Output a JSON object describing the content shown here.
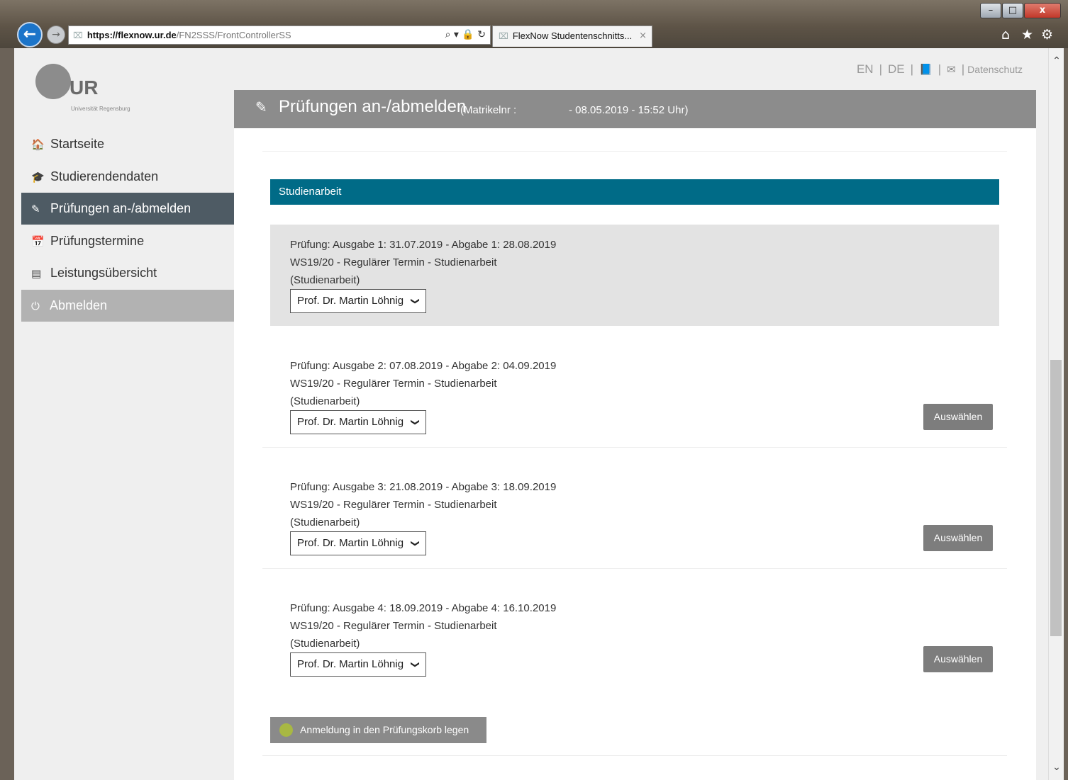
{
  "browser": {
    "url_host": "https://flexnow.ur.de",
    "url_path": "/FN2SSS/FrontControllerSS",
    "tab_title": "FlexNow Studentenschnitts...",
    "back_icon": "←",
    "forward_icon": "→",
    "minimize": "–",
    "maximize": "□",
    "close": "x",
    "tab_close": "×",
    "home_icon": "⌂",
    "favorites_icon": "★",
    "settings_icon": "⚙",
    "addr_tools": "⌕ ▾ 🔒 ↻"
  },
  "logo": {
    "letters": "UR",
    "subtitle": "Universität Regensburg"
  },
  "toplinks": {
    "en": "EN",
    "de": "DE",
    "sep": "|",
    "book_icon": "📘",
    "mail_icon": "✉",
    "privacy": "Datenschutz"
  },
  "sidebar": {
    "items": [
      {
        "icon": "🏠",
        "label": "Startseite"
      },
      {
        "icon": "🎓",
        "label": "Studierendendaten"
      },
      {
        "icon": "✎",
        "label": "Prüfungen an-/abmelden"
      },
      {
        "icon": "📅",
        "label": "Prüfungstermine"
      },
      {
        "icon": "▤",
        "label": "Leistungsübersicht"
      },
      {
        "icon": "⏻",
        "label": "Abmelden"
      }
    ]
  },
  "header": {
    "icon": "✎",
    "title": "Prüfungen an-/abmelden",
    "matrikel": "(Matrikelnr :",
    "datetime": "- 08.05.2019 - 15:52 Uhr)"
  },
  "section": {
    "title": "Studienarbeit"
  },
  "exams": [
    {
      "line1": "Prüfung: Ausgabe 1: 31.07.2019 - Abgabe 1: 28.08.2019",
      "line2": "WS19/20 - Regulärer Termin - Studienarbeit",
      "line3": "(Studienarbeit)",
      "examiner": "Prof. Dr. Martin Löhnig",
      "button": ""
    },
    {
      "line1": "Prüfung: Ausgabe 2: 07.08.2019 - Abgabe 2: 04.09.2019",
      "line2": "WS19/20 - Regulärer Termin - Studienarbeit",
      "line3": "(Studienarbeit)",
      "examiner": "Prof. Dr. Martin Löhnig",
      "button": "Auswählen"
    },
    {
      "line1": "Prüfung: Ausgabe 3: 21.08.2019 - Abgabe 3: 18.09.2019",
      "line2": "WS19/20 - Regulärer Termin - Studienarbeit",
      "line3": "(Studienarbeit)",
      "examiner": "Prof. Dr. Martin Löhnig",
      "button": "Auswählen"
    },
    {
      "line1": "Prüfung: Ausgabe 4: 18.09.2019 - Abgabe 4: 16.10.2019",
      "line2": "WS19/20 - Regulärer Termin - Studienarbeit",
      "line3": "(Studienarbeit)",
      "examiner": "Prof. Dr. Martin Löhnig",
      "button": "Auswählen"
    }
  ],
  "select_chevron": "❯",
  "basket_button": "Anmeldung in den Prüfungskorb legen",
  "scroll": {
    "up": "⌃",
    "down": "⌄"
  },
  "colors": {
    "section_header": "#006b87",
    "active_nav": "#4e5b64",
    "page_header": "#8c8c8c",
    "basket_icon": "#a8b843"
  }
}
